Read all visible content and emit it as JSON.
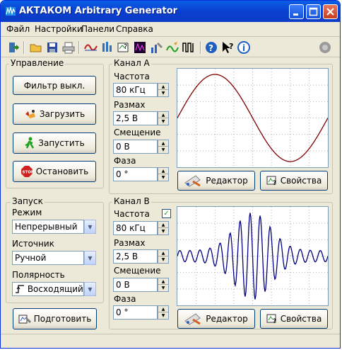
{
  "window": {
    "title": "АКТАКОМ Arbitrary Generator"
  },
  "menu": {
    "items": [
      "Файл",
      "Настройки",
      "Панели",
      "Справка"
    ]
  },
  "toolbar": {
    "icons": [
      "exit-icon",
      "open-folder-icon",
      "save-disk-icon",
      "print-icon",
      "waveform-icon",
      "equalizer-icon",
      "help-context-icon",
      "spectrum-icon",
      "tools-icon",
      "pencil-chart-icon",
      "pulse-icon",
      "help-icon",
      "whats-this-icon",
      "info-icon",
      "connect-icon"
    ]
  },
  "control": {
    "group_label": "Управление",
    "filter_button": "Фильтр выкл.",
    "load_button": "Загрузить",
    "start_button": "Запустить",
    "stop_button": "Остановить"
  },
  "trigger": {
    "group_label": "Запуск",
    "mode_label": "Режим",
    "mode_value": "Непрерывный",
    "source_label": "Источник",
    "source_value": "Ручной",
    "polarity_label": "Полярность",
    "polarity_value": "Восходящий",
    "prepare_button": "Подготовить"
  },
  "channel_a": {
    "group_label": "Канал A",
    "freq_label": "Частота",
    "freq_value": "80 кГц",
    "ampl_label": "Размах",
    "ampl_value": "2,5 В",
    "offset_label": "Смещение",
    "offset_value": "0 В",
    "phase_label": "Фаза",
    "phase_value": "0 °",
    "editor_button": "Редактор",
    "props_button": "Свойства",
    "waveform": "sine",
    "wave_color": "#800000"
  },
  "channel_b": {
    "group_label": "Канал B",
    "freq_label": "Частота",
    "freq_checked": true,
    "freq_value": "80 кГц",
    "ampl_label": "Размах",
    "ampl_value": "2,5 В",
    "offset_label": "Смещение",
    "offset_value": "0 В",
    "phase_label": "Фаза",
    "phase_value": "0 °",
    "editor_button": "Редактор",
    "props_button": "Свойства",
    "waveform": "modulated-burst",
    "wave_color": "#000080"
  }
}
